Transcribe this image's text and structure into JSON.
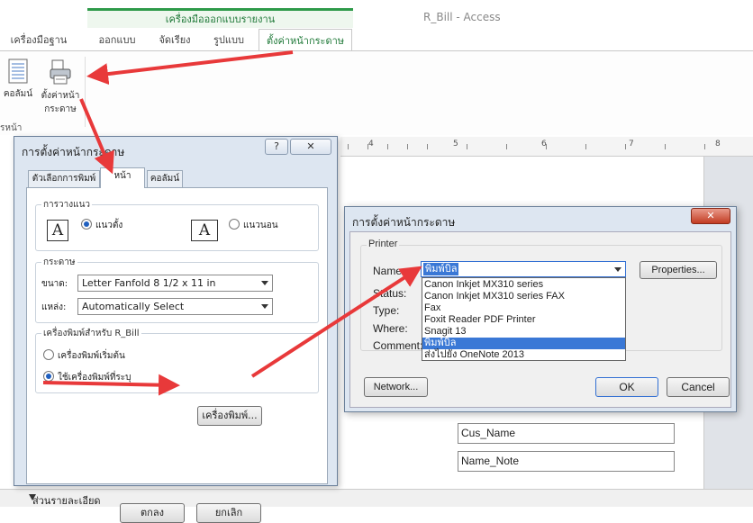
{
  "ribbon": {
    "tool_group": "เครื่องมือออกแบบรายงาน",
    "window_title": "R_Bill - Access",
    "tabs": [
      "เครื่องมือฐานข้อมูล",
      "ออกแบบ",
      "จัดเรียง",
      "รูปแบบ",
      "ตั้งค่าหน้ากระดาษ"
    ],
    "buttons": {
      "columns": "คอลัมน์",
      "page_setup_1": "ตั้งค่าหน้า",
      "page_setup_2": "กระดาษ"
    },
    "group_label": "รหน้า"
  },
  "ruler": {
    "numbers": [
      "4",
      "5",
      "6",
      "7",
      "8"
    ]
  },
  "designer": {
    "fields": [
      "Cus_Name",
      "Name_Note"
    ],
    "detail_label": "ส่วนรายละเอียด"
  },
  "dialog_th": {
    "title": "การตั้งค่าหน้ากระดาษ",
    "help": "?",
    "close": "✕",
    "tabs": [
      "ตัวเลือกการพิมพ์",
      "หน้า",
      "คอลัมน์"
    ],
    "orientation": {
      "label": "การวางแนว",
      "portrait": "แนวตั้ง",
      "landscape": "แนวนอน",
      "glyph": "A",
      "selected": "portrait"
    },
    "paper": {
      "label": "กระดาษ",
      "size_label": "ขนาด:",
      "size_value": "Letter Fanfold 8 1/2 x 11 in",
      "source_label": "แหล่ง:",
      "source_value": "Automatically Select"
    },
    "printer": {
      "label": "เครื่องพิมพ์สำหรับ R_Bill",
      "default": "เครื่องพิมพ์เริ่มต้น",
      "specific": "ใช้เครื่องพิมพ์ที่ระบุ",
      "selected": "specific",
      "button": "เครื่องพิมพ์..."
    },
    "ok": "ตกลง",
    "cancel": "ยกเลิก"
  },
  "dialog_en": {
    "title": "การตั้งค่าหน้ากระดาษ",
    "close": "✕",
    "group": "Printer",
    "labels": {
      "name": "Name:",
      "status": "Status:",
      "type": "Type:",
      "where": "Where:",
      "comment": "Comment:"
    },
    "name_value": "พิมพ์บิล",
    "properties": "Properties...",
    "network": "Network...",
    "ok": "OK",
    "cancel": "Cancel",
    "printer_options": [
      "Canon Inkjet MX310 series",
      "Canon Inkjet MX310 series FAX",
      "Fax",
      "Foxit Reader PDF Printer",
      "Snagit 13",
      "พิมพ์บิล",
      "ส่งไปยัง OneNote 2013"
    ],
    "selected_index": 5
  },
  "colors": {
    "tool_green": "#217a3a",
    "highlight": "#3a78d6",
    "arrow_red": "#e8393a",
    "dialog_bg": "#dde6f1"
  }
}
